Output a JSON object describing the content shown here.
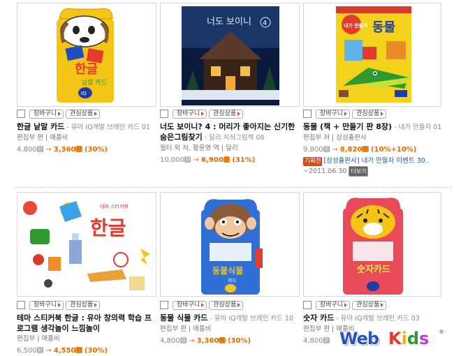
{
  "products": [
    {
      "basket_label": "장바구니",
      "wish_label": "관심상품",
      "title_bold": "한글 낱말 카드",
      "title_sub": " - 유아 IQ개발 브레인 카드 01",
      "meta": "편집부 편 | 애플비",
      "list_price": "4,800",
      "sale_price": "3,360",
      "discount": "(30%)",
      "cover_title": "한글낱말카드"
    },
    {
      "basket_label": "장바구니",
      "wish_label": "관심상품",
      "title_bold": "너도 보이니? 4 : 머리가 좋아지는 신기한 숨은그림찾기",
      "title_sub": " - 달리 지식그림책 08",
      "meta": "월터 윅 저, 황윤영 역 | 달리",
      "list_price": "10,000",
      "sale_price": "6,900",
      "discount": "(31%)",
      "cover_title": "너도 보이니",
      "cover_num": "4"
    },
    {
      "basket_label": "장바구니",
      "wish_label": "관심상품",
      "title_bold": "동물 (책 + 만들기 판 8장)",
      "title_sub": " - 내가 만들자 01",
      "meta": "편집부 저 | 삼성출판사",
      "list_price": "9,800",
      "sale_price": "8,820",
      "discount": "(10%+10%)",
      "event_tag": "기획전",
      "event_text": "[삼성출판사] 내가 만들자 이벤트 30..",
      "event_date": "~2011.06.30",
      "event_more": "더보기",
      "cover_title": "동물",
      "cover_badge": "내가 만들자"
    },
    {
      "basket_label": "장바구니",
      "wish_label": "관심상품",
      "title_bold": "테마 스티커북 한글 : 유아 창의력 학습 프로그램 생각놀이 느낌놀이",
      "title_sub": "",
      "meta": "편집부 | 애플비",
      "list_price": "6,500",
      "sale_price": "4,550",
      "discount": "(30%)",
      "cover_title": "한글"
    },
    {
      "basket_label": "장바구니",
      "wish_label": "관심상품",
      "title_bold": "동물 식물 카드",
      "title_sub": " - 유아 IQ개발 브레인 카드 10",
      "meta": "편집부 편 | 애플비",
      "list_price": "4,800",
      "sale_price": "3,360",
      "discount": "(30%)",
      "cover_title": "동물식물카드"
    },
    {
      "basket_label": "장바구니",
      "wish_label": "관심상품",
      "title_bold": "숫자 카드",
      "title_sub": " - 유아 IQ개발 브레인 카드 03",
      "meta": "편집부 편 | 애플비",
      "list_price": "4,800",
      "sale_price": "",
      "discount": "",
      "cover_title": "숫자카드"
    }
  ],
  "logo": {
    "web": "Web",
    "kids": "Kids",
    "reg": "®"
  },
  "won_symbol": "원",
  "arrow": "→"
}
